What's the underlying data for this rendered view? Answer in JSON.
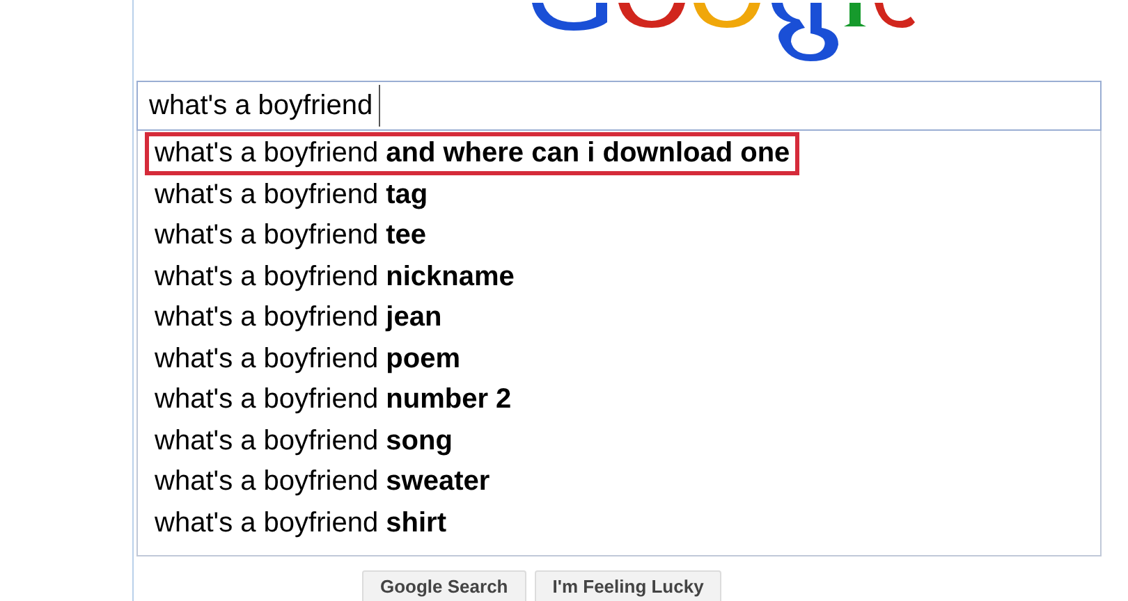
{
  "search": {
    "value": "what's a boyfriend"
  },
  "suggestions": [
    {
      "text": "what's a boyfriend **and where can i download one**",
      "highlighted": true
    },
    {
      "text": "what's a boyfriend **tag**",
      "highlighted": false
    },
    {
      "text": "what's a boyfriend **tee**",
      "highlighted": false
    },
    {
      "text": "what's a boyfriend **nickname**",
      "highlighted": false
    },
    {
      "text": "what's a boyfriend **jean**",
      "highlighted": false
    },
    {
      "text": "what's a boyfriend **poem**",
      "highlighted": false
    },
    {
      "text": "what's a boyfriend **number 2**",
      "highlighted": false
    },
    {
      "text": "what's a boyfriend **song**",
      "highlighted": false
    },
    {
      "text": "what's a boyfriend **sweater**",
      "highlighted": false
    },
    {
      "text": "what's a boyfriend **shirt**",
      "highlighted": false
    }
  ],
  "buttons": [
    "Google Search",
    "I'm Feeling Lucky"
  ]
}
